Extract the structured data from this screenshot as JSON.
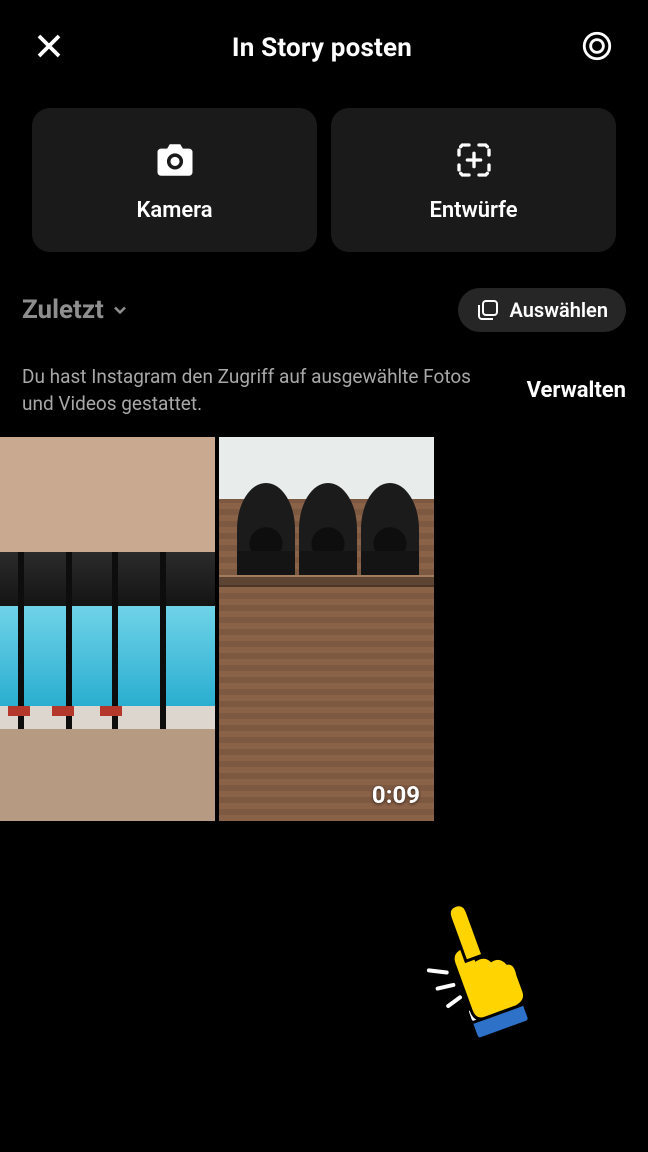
{
  "header": {
    "title": "In Story posten"
  },
  "actions": {
    "camera_label": "Kamera",
    "drafts_label": "Entwürfe"
  },
  "filter": {
    "recent_label": "Zuletzt",
    "select_label": "Auswählen"
  },
  "access": {
    "message": "Du hast Instagram den Zugriff auf ausgewählte Fotos und Videos gestattet.",
    "manage_label": "Verwalten"
  },
  "gallery": {
    "items": [
      {
        "kind": "photo",
        "description": "indoor-pool"
      },
      {
        "kind": "video",
        "description": "brick-bell-tower",
        "duration": "0:09"
      }
    ]
  },
  "icons": {
    "close": "close-icon",
    "settings": "settings-gear-icon",
    "camera": "camera-icon",
    "drafts": "drafts-add-icon",
    "chevron": "chevron-down-icon",
    "multiselect": "multiselect-icon",
    "hand": "pointing-hand-graphic"
  },
  "colors": {
    "background": "#000000",
    "card": "#1a1a1a",
    "pill": "#262626",
    "muted_text": "#a8a8a8",
    "dim_text": "#8e8e8e"
  }
}
